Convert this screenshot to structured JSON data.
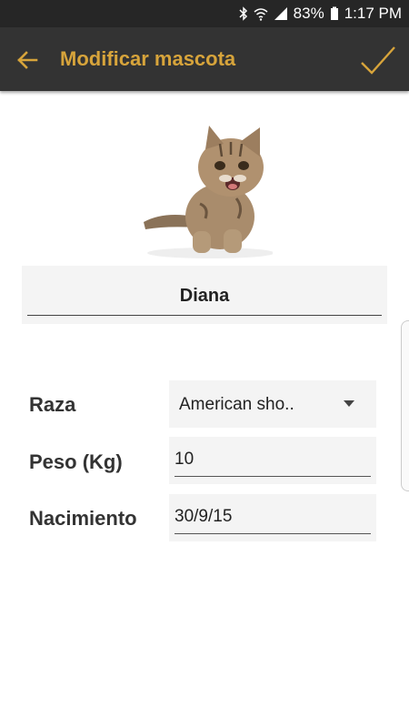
{
  "status_bar": {
    "battery_text": "83%",
    "time": "1:17 PM"
  },
  "app_bar": {
    "title": "Modificar mascota",
    "accent_color": "#d7a43b",
    "background": "#333333"
  },
  "pet": {
    "name": "Diana",
    "photo": "tabby-kitten-photo"
  },
  "form": {
    "breed": {
      "label": "Raza",
      "value": "American sho.."
    },
    "weight": {
      "label": "Peso (Kg)",
      "value": "10"
    },
    "birth": {
      "label": "Nacimiento",
      "value": "30/9/15"
    }
  }
}
